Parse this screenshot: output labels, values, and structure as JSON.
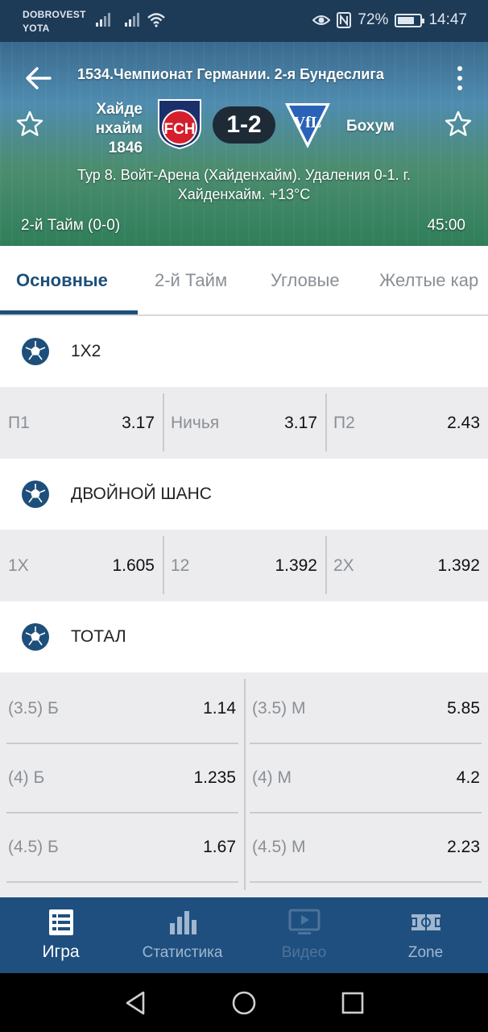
{
  "status_bar": {
    "carrier_line1": "DOBROVEST",
    "carrier_line2": "YOTA",
    "battery": "72%",
    "time": "14:47"
  },
  "match": {
    "league": "1534.Чемпионат Германии. 2-я Бундеслига",
    "home_team_line1": "Хайде",
    "home_team_line2": "нхайм",
    "home_team_line3": "1846",
    "home_logo_text": "FCH",
    "score": "1-2",
    "away_team": "Бохум",
    "away_logo_text": "VfL",
    "info": "Тур 8. Войт-Арена (Хайденхайм). Удаления 0-1. г. Хайденхайм. +13°C",
    "period": "2-й  Тайм (0-0)",
    "clock": "45:00"
  },
  "tabs": [
    {
      "label": "Основные",
      "active": true
    },
    {
      "label": "2-й  Тайм",
      "active": false
    },
    {
      "label": "Угловые",
      "active": false
    },
    {
      "label": "Желтые кар",
      "active": false
    }
  ],
  "markets": {
    "m1x2": {
      "title": "1X2",
      "outcomes": [
        {
          "label": "П1",
          "odds": "3.17"
        },
        {
          "label": "Ничья",
          "odds": "3.17"
        },
        {
          "label": "П2",
          "odds": "2.43"
        }
      ]
    },
    "double": {
      "title": "ДВОЙНОЙ ШАНС",
      "outcomes": [
        {
          "label": "1X",
          "odds": "1.605"
        },
        {
          "label": "12",
          "odds": "1.392"
        },
        {
          "label": "2X",
          "odds": "1.392"
        }
      ]
    },
    "total": {
      "title": "ТОТАЛ",
      "rows": [
        {
          "over_label": "(3.5) Б",
          "over_odds": "1.14",
          "under_label": "(3.5) М",
          "under_odds": "5.85"
        },
        {
          "over_label": "(4) Б",
          "over_odds": "1.235",
          "under_label": "(4) М",
          "under_odds": "4.2"
        },
        {
          "over_label": "(4.5) Б",
          "over_odds": "1.67",
          "under_label": "(4.5) М",
          "under_odds": "2.23"
        }
      ]
    }
  },
  "bottom_nav": [
    {
      "label": "Игра",
      "icon": "list-icon",
      "state": "active"
    },
    {
      "label": "Статистика",
      "icon": "bar-chart-icon",
      "state": "normal"
    },
    {
      "label": "Видео",
      "icon": "video-icon",
      "state": "disabled"
    },
    {
      "label": "Zone",
      "icon": "field-icon",
      "state": "normal"
    }
  ],
  "colors": {
    "primary": "#1d4f7a",
    "nav_bg": "#1f4f7f",
    "status_bg": "#1d3b57",
    "ball_icon": "#1d4f7a"
  }
}
